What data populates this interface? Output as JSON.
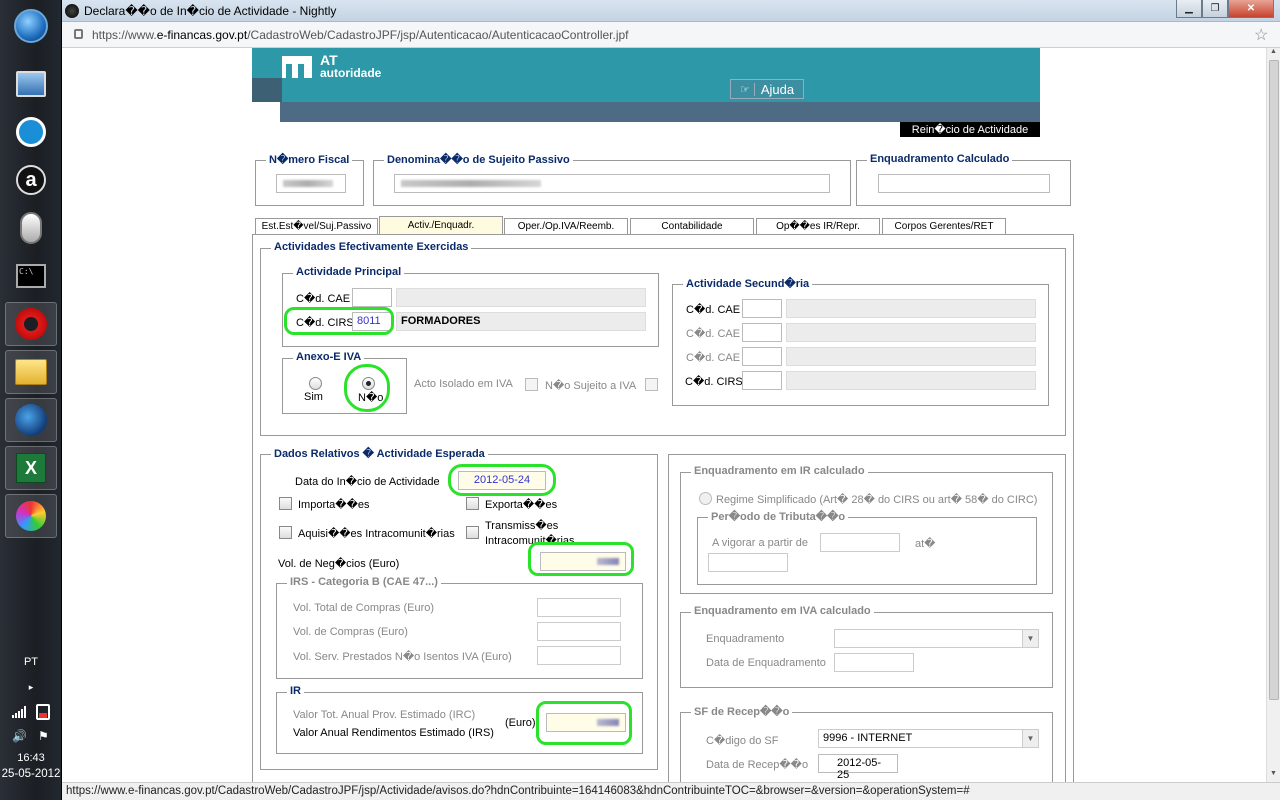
{
  "window": {
    "title": "Declara��o de In�cio de Actividade - Nightly",
    "url_prefix": "https://www.",
    "url_domain": "e-financas.gov.pt",
    "url_path": "/CadastroWeb/CadastroJPF/jsp/Autenticacao/AutenticacaoController.jpf",
    "status_url": "https://www.e-financas.gov.pt/CadastroWeb/CadastroJPF/jsp/Actividade/avisos.do?hdnContribuinte=164146083&hdnContribuinteTOC=&browser=&version=&operationSystem=#"
  },
  "taskbar": {
    "lang": "PT",
    "time": "16:43",
    "date": "25-05-2012"
  },
  "header": {
    "logo_at": "AT",
    "logo_sub": "autoridade",
    "ajuda": "Ajuda",
    "reinicio": "Rein�cio de Actividade"
  },
  "top": {
    "nif_legend": "N�mero Fiscal",
    "denom_legend": "Denomina��o de Sujeito Passivo",
    "enq_legend": "Enquadramento Calculado"
  },
  "tabs": [
    "Est.Est�vel/Suj.Passivo",
    "Activ./Enquadr.",
    "Oper./Op.IVA/Reemb.",
    "Contabilidade",
    "Op��es IR/Repr.",
    "Corpos Gerentes/RET"
  ],
  "actividades": {
    "legend": "Actividades Efectivamente Exercidas",
    "principal_legend": "Actividade Principal",
    "cod_cae": "C�d. CAE",
    "cod_cirs": "C�d. CIRS",
    "cirs_value": "8011",
    "cirs_desc": "FORMADORES",
    "secundaria_legend": "Actividade Secund�ria",
    "anexo_legend": "Anexo-E IVA",
    "sim": "Sim",
    "nao": "N�o",
    "acto_isolado": "Acto Isolado em IVA",
    "nao_sujeito": "N�o Sujeito a IVA"
  },
  "dados": {
    "legend": "Dados Relativos � Actividade Esperada",
    "data_inicio_label": "Data do In�cio de Actividade",
    "data_inicio_value": "2012-05-24",
    "importacoes": "Importa��es",
    "exportacoes": "Exporta��es",
    "aquisicoes": "Aquisi��es Intracomunit�rias",
    "transmissoes_1": "Transmiss�es",
    "transmissoes_2": "Intracomunit�rias",
    "vol_negocios": "Vol. de Neg�cios (Euro)",
    "irs_legend": "IRS - Categoria B (CAE 47...)",
    "vol_compras_total": "Vol. Total de Compras (Euro)",
    "vol_compras": "Vol. de Compras (Euro)",
    "vol_servicos": "Vol. Serv. Prestados N�o Isentos IVA (Euro)",
    "ir_legend": "IR",
    "valor_irc": "Valor Tot. Anual Prov. Estimado (IRC)",
    "valor_irs": "Valor Anual Rendimentos Estimado (IRS)",
    "euro": "(Euro)"
  },
  "enq_ir": {
    "legend": "Enquadramento em IR calculado",
    "regime": "Regime Simplificado (Art� 28� do CIRS ou art� 58� do CIRC)",
    "periodo_legend": "Per�odo de Tributa��o",
    "vigorar": "A vigorar a partir de",
    "ate": "at�"
  },
  "enq_iva": {
    "legend": "Enquadramento em IVA calculado",
    "enquadramento": "Enquadramento",
    "data_enq": "Data de Enquadramento"
  },
  "sf": {
    "legend": "SF de Recep��o",
    "codigo_label": "C�digo do SF",
    "codigo_value": "9996 - INTERNET",
    "data_label": "Data de Recep��o",
    "data_value": "2012-05-25"
  }
}
